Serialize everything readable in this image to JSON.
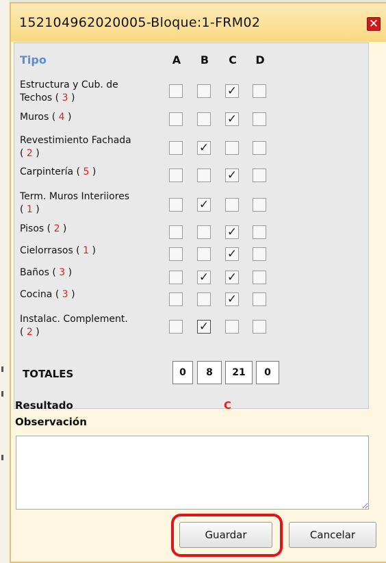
{
  "window": {
    "title": "152104962020005-Bloque:1-FRM02",
    "close_symbol": "✕"
  },
  "table": {
    "header_tipo": "Tipo",
    "columns": [
      "A",
      "B",
      "C",
      "D"
    ],
    "rows": [
      {
        "label": "Estructura y Cub. de",
        "label2": "Techos",
        "count": "3",
        "checked": "C"
      },
      {
        "label": "Muros",
        "count": "4",
        "checked": "C"
      },
      {
        "label": "Revestimiento Fachada",
        "count": "2",
        "checked": "B"
      },
      {
        "label": "Carpintería",
        "count": "5",
        "checked": "C"
      },
      {
        "label": "Term. Muros Interiiores",
        "count": "1",
        "checked": "B"
      },
      {
        "label": "Pisos",
        "count": "2",
        "checked": "C"
      },
      {
        "label": "Cielorrasos",
        "count": "1",
        "checked": "C"
      },
      {
        "label": "Baños",
        "count": "3",
        "checked": "B,C"
      },
      {
        "label": "Cocina",
        "count": "3",
        "checked": "C"
      },
      {
        "label": "Instalac. Complement.",
        "count": "2",
        "checked": "B"
      }
    ],
    "check_symbol": "✓"
  },
  "totals": {
    "label": "TOTALES",
    "values": [
      "0",
      "8",
      "21",
      "0"
    ]
  },
  "result": {
    "label": "Resultado",
    "value": "C"
  },
  "observation": {
    "label": "Observación",
    "value": ""
  },
  "buttons": {
    "save": "Guardar",
    "cancel": "Cancelar"
  },
  "colors": {
    "title_bar": "#f9d982",
    "close": "#d0191a",
    "tipo_header": "#5b8ed6",
    "count_red": "#e02020",
    "highlight": "#e0141b"
  }
}
